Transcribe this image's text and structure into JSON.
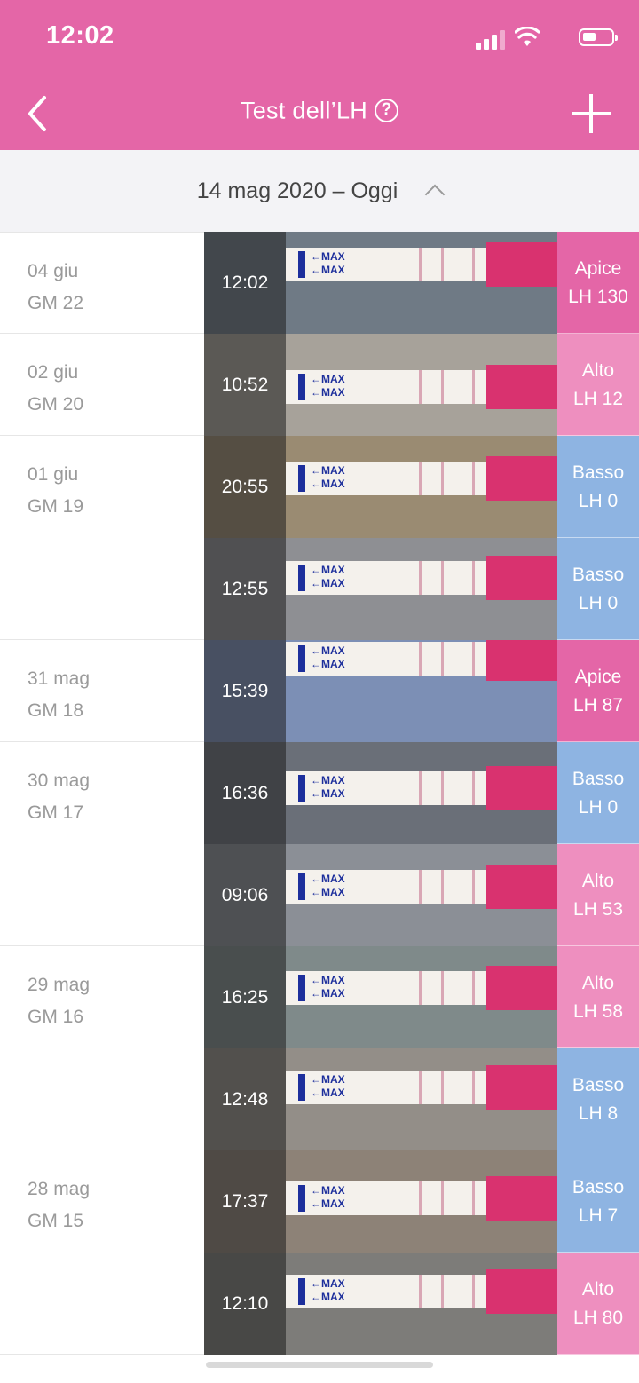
{
  "status_bar": {
    "time": "12:02"
  },
  "header": {
    "title": "Test dell’LH",
    "help_icon": "question-circle-icon"
  },
  "date_bar": {
    "label": "14 mag 2020 – Oggi"
  },
  "colors": {
    "apice": "#e466a7",
    "alto": "#ee8fbf",
    "basso": "#8eb4e2",
    "header": "#e466a7"
  },
  "rows": [
    {
      "date": "04 giu",
      "cycle_day": "GM 22",
      "time": "12:02",
      "level": "Apice",
      "lh": "LH 130",
      "type": "apice"
    },
    {
      "date": "02 giu",
      "cycle_day": "GM 20",
      "time": "10:52",
      "level": "Alto",
      "lh": "LH 12",
      "type": "alto"
    },
    {
      "date": "01 giu",
      "cycle_day": "GM 19",
      "time": "20:55",
      "level": "Basso",
      "lh": "LH 0",
      "type": "basso"
    },
    {
      "date": "",
      "cycle_day": "",
      "time": "12:55",
      "level": "Basso",
      "lh": "LH 0",
      "type": "basso"
    },
    {
      "date": "31 mag",
      "cycle_day": "GM 18",
      "time": "15:39",
      "level": "Apice",
      "lh": "LH 87",
      "type": "apice"
    },
    {
      "date": "30 mag",
      "cycle_day": "GM 17",
      "time": "16:36",
      "level": "Basso",
      "lh": "LH 0",
      "type": "basso"
    },
    {
      "date": "",
      "cycle_day": "",
      "time": "09:06",
      "level": "Alto",
      "lh": "LH 53",
      "type": "alto"
    },
    {
      "date": "29 mag",
      "cycle_day": "GM 16",
      "time": "16:25",
      "level": "Alto",
      "lh": "LH 58",
      "type": "alto"
    },
    {
      "date": "",
      "cycle_day": "",
      "time": "12:48",
      "level": "Basso",
      "lh": "LH 8",
      "type": "basso"
    },
    {
      "date": "28 mag",
      "cycle_day": "GM 15",
      "time": "17:37",
      "level": "Basso",
      "lh": "LH 7",
      "type": "basso"
    },
    {
      "date": "",
      "cycle_day": "",
      "time": "12:10",
      "level": "Alto",
      "lh": "LH 80",
      "type": "alto"
    }
  ]
}
